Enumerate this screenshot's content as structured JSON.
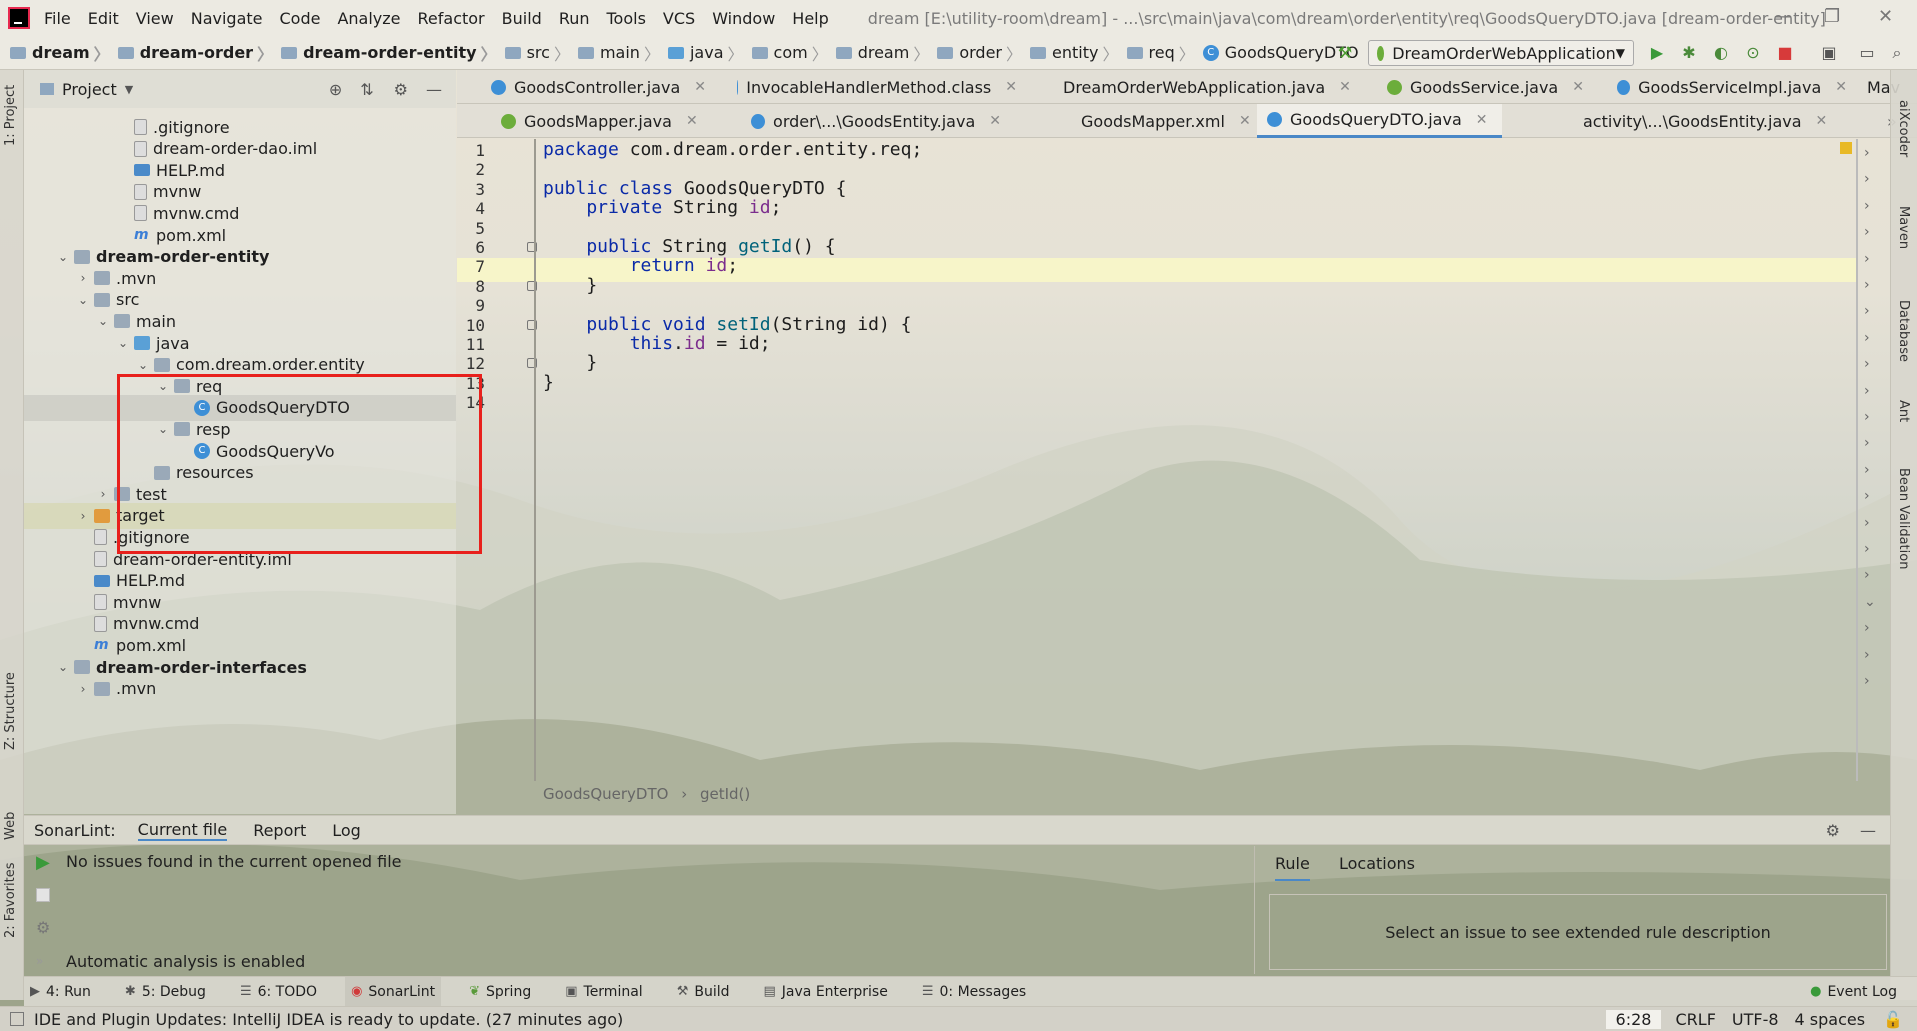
{
  "menubar": {
    "items": [
      "File",
      "Edit",
      "View",
      "Navigate",
      "Code",
      "Analyze",
      "Refactor",
      "Build",
      "Run",
      "Tools",
      "VCS",
      "Window",
      "Help"
    ],
    "title": "dream [E:\\utility-room\\dream] - ...\\src\\main\\java\\com\\dream\\order\\entity\\req\\GoodsQueryDTO.java [dream-order-entity]"
  },
  "navbar": {
    "crumbs": [
      "dream",
      "dream-order",
      "dream-order-entity",
      "src",
      "main",
      "java",
      "com",
      "dream",
      "order",
      "entity",
      "req",
      "GoodsQueryDTO"
    ],
    "run_config": "DreamOrderWebApplication"
  },
  "left_stripe": {
    "project": "1: Project",
    "structure": "Z: Structure",
    "web": "Web",
    "favorites": "2: Favorites"
  },
  "project_panel": {
    "title": "Project",
    "tree": [
      {
        "label": ".gitignore",
        "icon": "file"
      },
      {
        "label": "dream-order-dao.iml",
        "icon": "file"
      },
      {
        "label": "HELP.md",
        "icon": "md"
      },
      {
        "label": "mvnw",
        "icon": "file"
      },
      {
        "label": "mvnw.cmd",
        "icon": "file"
      },
      {
        "label": "pom.xml",
        "icon": "m"
      },
      {
        "label": "dream-order-entity",
        "icon": "folder"
      },
      {
        "label": ".mvn",
        "icon": "folder"
      },
      {
        "label": "src",
        "icon": "folder"
      },
      {
        "label": "main",
        "icon": "folder"
      },
      {
        "label": "java",
        "icon": "src"
      },
      {
        "label": "com.dream.order.entity",
        "icon": "folder"
      },
      {
        "label": "req",
        "icon": "folder"
      },
      {
        "label": "GoodsQueryDTO",
        "icon": "cls"
      },
      {
        "label": "resp",
        "icon": "folder"
      },
      {
        "label": "GoodsQueryVo",
        "icon": "cls"
      },
      {
        "label": "resources",
        "icon": "folder"
      },
      {
        "label": "test",
        "icon": "folder"
      },
      {
        "label": "target",
        "icon": "orange"
      },
      {
        "label": ".gitignore",
        "icon": "file"
      },
      {
        "label": "dream-order-entity.iml",
        "icon": "file"
      },
      {
        "label": "HELP.md",
        "icon": "md"
      },
      {
        "label": "mvnw",
        "icon": "file"
      },
      {
        "label": "mvnw.cmd",
        "icon": "file"
      },
      {
        "label": "pom.xml",
        "icon": "m"
      },
      {
        "label": "dream-order-interfaces",
        "icon": "folder"
      },
      {
        "label": ".mvn",
        "icon": "folder"
      }
    ]
  },
  "editor": {
    "tabs_row1": [
      "GoodsController.java",
      "InvocableHandlerMethod.class",
      "DreamOrderWebApplication.java",
      "GoodsService.java",
      "GoodsServiceImpl.java",
      "Mav"
    ],
    "tabs_row2": [
      "GoodsMapper.java",
      "order\\...\\GoodsEntity.java",
      "GoodsMapper.xml",
      "GoodsQueryDTO.java",
      "activity\\...\\GoodsEntity.java"
    ],
    "line_numbers": [
      "1",
      "2",
      "3",
      "4",
      "5",
      "6",
      "7",
      "8",
      "9",
      "10",
      "11",
      "12",
      "13",
      "14"
    ],
    "code": [
      [
        {
          "t": "package ",
          "c": "kw"
        },
        {
          "t": "com.dream.order.entity.req;",
          "c": "pl"
        }
      ],
      [],
      [
        {
          "t": "public class ",
          "c": "kw"
        },
        {
          "t": "GoodsQueryDTO {",
          "c": "pl"
        }
      ],
      [
        {
          "t": "    private ",
          "c": "kw"
        },
        {
          "t": "String ",
          "c": "pl"
        },
        {
          "t": "id",
          "c": "fld"
        },
        {
          "t": ";",
          "c": "pl"
        }
      ],
      [],
      [
        {
          "t": "    public ",
          "c": "kw"
        },
        {
          "t": "String ",
          "c": "pl"
        },
        {
          "t": "getId",
          "c": "fn"
        },
        {
          "t": "() {",
          "c": "pl"
        }
      ],
      [
        {
          "t": "        return ",
          "c": "kw"
        },
        {
          "t": "id",
          "c": "fld"
        },
        {
          "t": ";",
          "c": "pl"
        }
      ],
      [
        {
          "t": "    }",
          "c": "pl"
        }
      ],
      [],
      [
        {
          "t": "    public void ",
          "c": "kw"
        },
        {
          "t": "setId",
          "c": "fn"
        },
        {
          "t": "(String id) {",
          "c": "pl"
        }
      ],
      [
        {
          "t": "        this",
          "c": "kw"
        },
        {
          "t": ".",
          "c": "pl"
        },
        {
          "t": "id",
          "c": "fld"
        },
        {
          "t": " = id;",
          "c": "pl"
        }
      ],
      [
        {
          "t": "    }",
          "c": "pl"
        }
      ],
      [
        {
          "t": "}",
          "c": "pl"
        }
      ],
      []
    ],
    "breadcrumb_class": "GoodsQueryDTO",
    "breadcrumb_method": "getId()"
  },
  "right_stripe": {
    "aixcoder": "aiXcoder",
    "maven": "Maven",
    "database": "Database",
    "ant": "Ant",
    "bean": "Bean Validation"
  },
  "sonar": {
    "label": "SonarLint:",
    "tabs": [
      "Current file",
      "Report",
      "Log"
    ],
    "message": "No issues found in the current opened file",
    "analysis": "Automatic analysis is enabled",
    "right_tabs": [
      "Rule",
      "Locations"
    ],
    "rule_placeholder": "Select an issue to see extended rule description"
  },
  "tool_windows": [
    "4: Run",
    "5: Debug",
    "6: TODO",
    "SonarLint",
    "Spring",
    "Terminal",
    "Build",
    "Java Enterprise",
    "0: Messages"
  ],
  "event_log": "Event Log",
  "statusbar": {
    "message": "IDE and Plugin Updates: IntelliJ IDEA is ready to update. (27 minutes ago)",
    "position": "6:28",
    "line_sep": "CRLF",
    "encoding": "UTF-8",
    "indent": "4 spaces"
  }
}
